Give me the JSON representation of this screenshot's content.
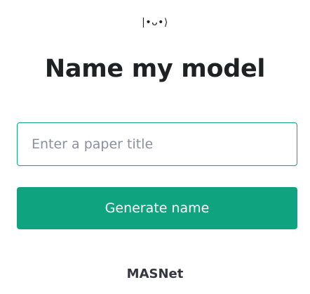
{
  "logo": {
    "text": "|•ᴗ•⟩"
  },
  "header": {
    "title": "Name my model"
  },
  "form": {
    "input_value": "",
    "input_placeholder": "Enter a paper title",
    "submit_label": "Generate name"
  },
  "result": {
    "name": "MASNet"
  },
  "colors": {
    "accent": "#10a37f",
    "text": "#202123",
    "placeholder": "#8e8ea0"
  }
}
